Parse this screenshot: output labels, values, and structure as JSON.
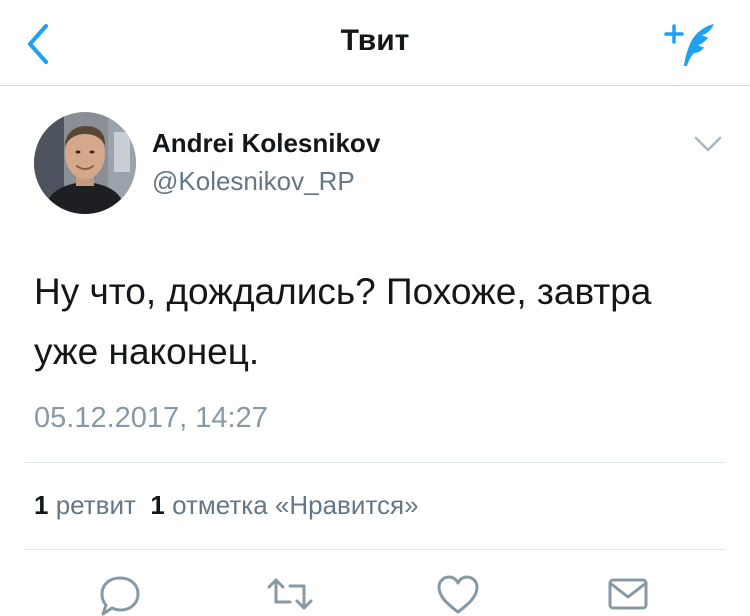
{
  "navbar": {
    "title": "Твит",
    "back_icon": "chevron-left-icon",
    "compose_icon": "compose-tweet-icon",
    "accent_color": "#1da1f2"
  },
  "tweet": {
    "author_name": "Andrei Kolesnikov",
    "author_handle": "@Kolesnikov_RP",
    "text": "Ну что, дождались? Похоже, завтра уже наконец.",
    "timestamp": "05.12.2017, 14:27",
    "menu_icon": "chevron-down-icon"
  },
  "stats": {
    "retweets_count": "1",
    "retweets_label": "ретвит",
    "likes_count": "1",
    "likes_label": "отметка «Нравится»"
  },
  "actions": [
    {
      "name": "reply",
      "icon": "reply-icon"
    },
    {
      "name": "retweet",
      "icon": "retweet-icon"
    },
    {
      "name": "like",
      "icon": "heart-icon"
    },
    {
      "name": "share",
      "icon": "envelope-icon"
    }
  ]
}
